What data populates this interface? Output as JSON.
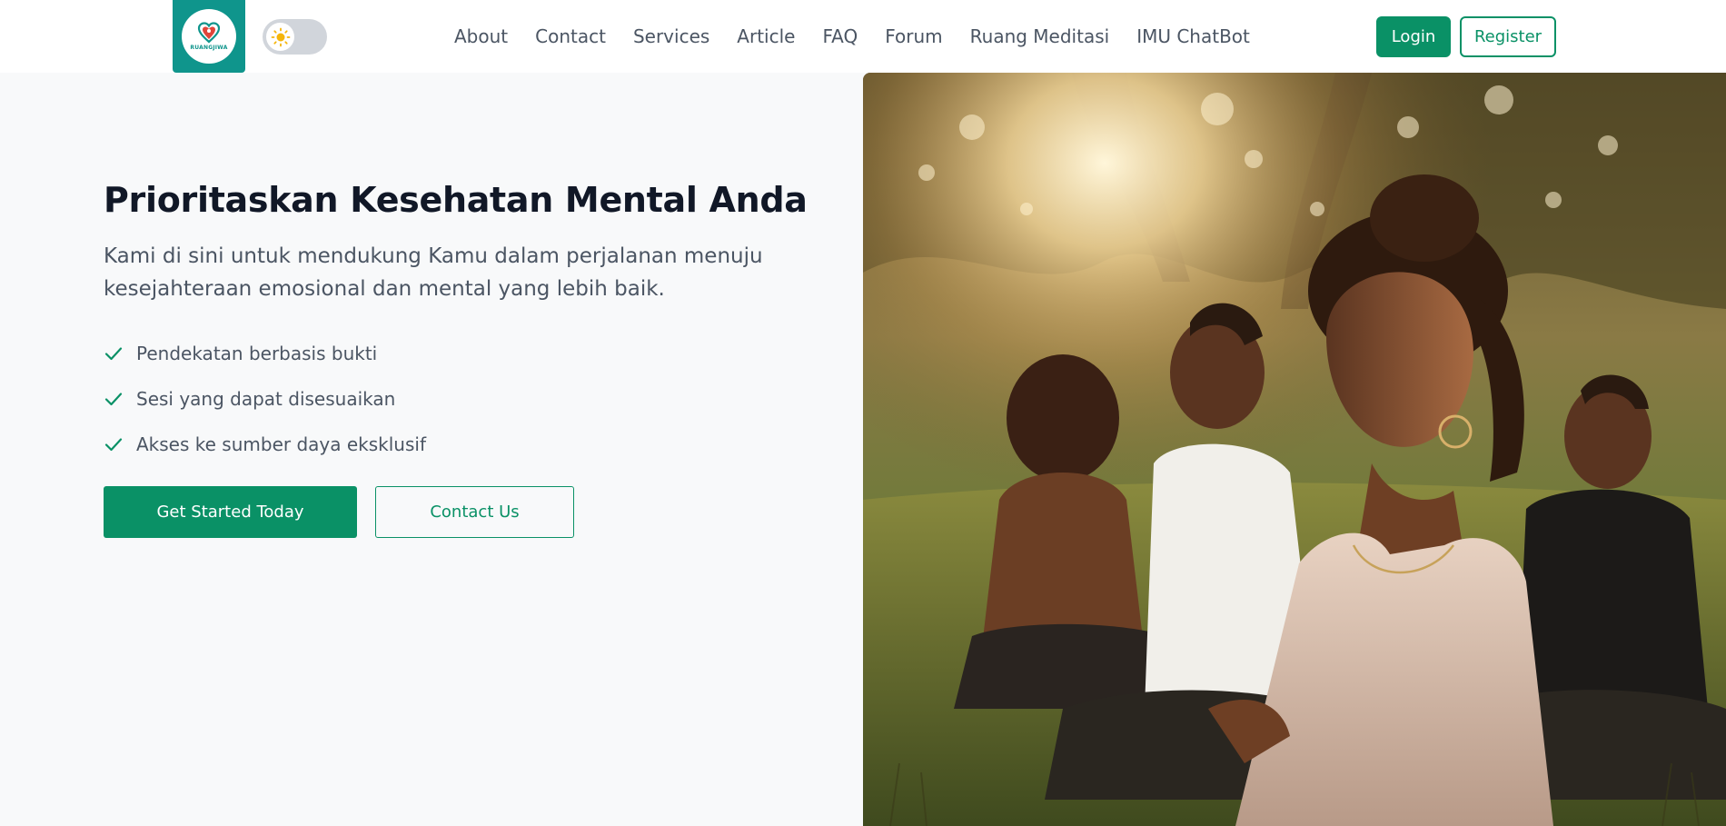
{
  "brand": {
    "logo_text": "RUANGJIWA",
    "logo_color": "#0f958c",
    "icon": "heart-people-logo"
  },
  "theme_toggle": {
    "icon": "sun-icon",
    "mode": "light"
  },
  "nav": {
    "links": [
      {
        "label": "About"
      },
      {
        "label": "Contact"
      },
      {
        "label": "Services"
      },
      {
        "label": "Article"
      },
      {
        "label": "FAQ"
      },
      {
        "label": "Forum"
      },
      {
        "label": "Ruang Meditasi"
      },
      {
        "label": "IMU ChatBot"
      }
    ],
    "login_label": "Login",
    "register_label": "Register"
  },
  "hero": {
    "title": "Prioritaskan Kesehatan Mental Anda",
    "subtitle": "Kami di sini untuk mendukung Kamu dalam perjalanan menuju kesejahteraan emosional dan mental yang lebih baik.",
    "features": [
      {
        "icon": "check-icon",
        "label": "Pendekatan berbasis bukti"
      },
      {
        "icon": "check-icon",
        "label": "Sesi yang dapat disesuaikan"
      },
      {
        "icon": "check-icon",
        "label": "Akses ke sumber daya eksklusif"
      }
    ],
    "cta_primary": "Get Started Today",
    "cta_secondary": "Contact Us",
    "image_subject": "people meditating outdoors at sunset"
  },
  "colors": {
    "accent": "#0a9166",
    "teal": "#0f958c",
    "background": "#f8f9fa",
    "heading": "#111827",
    "body_text": "#4b5563"
  }
}
